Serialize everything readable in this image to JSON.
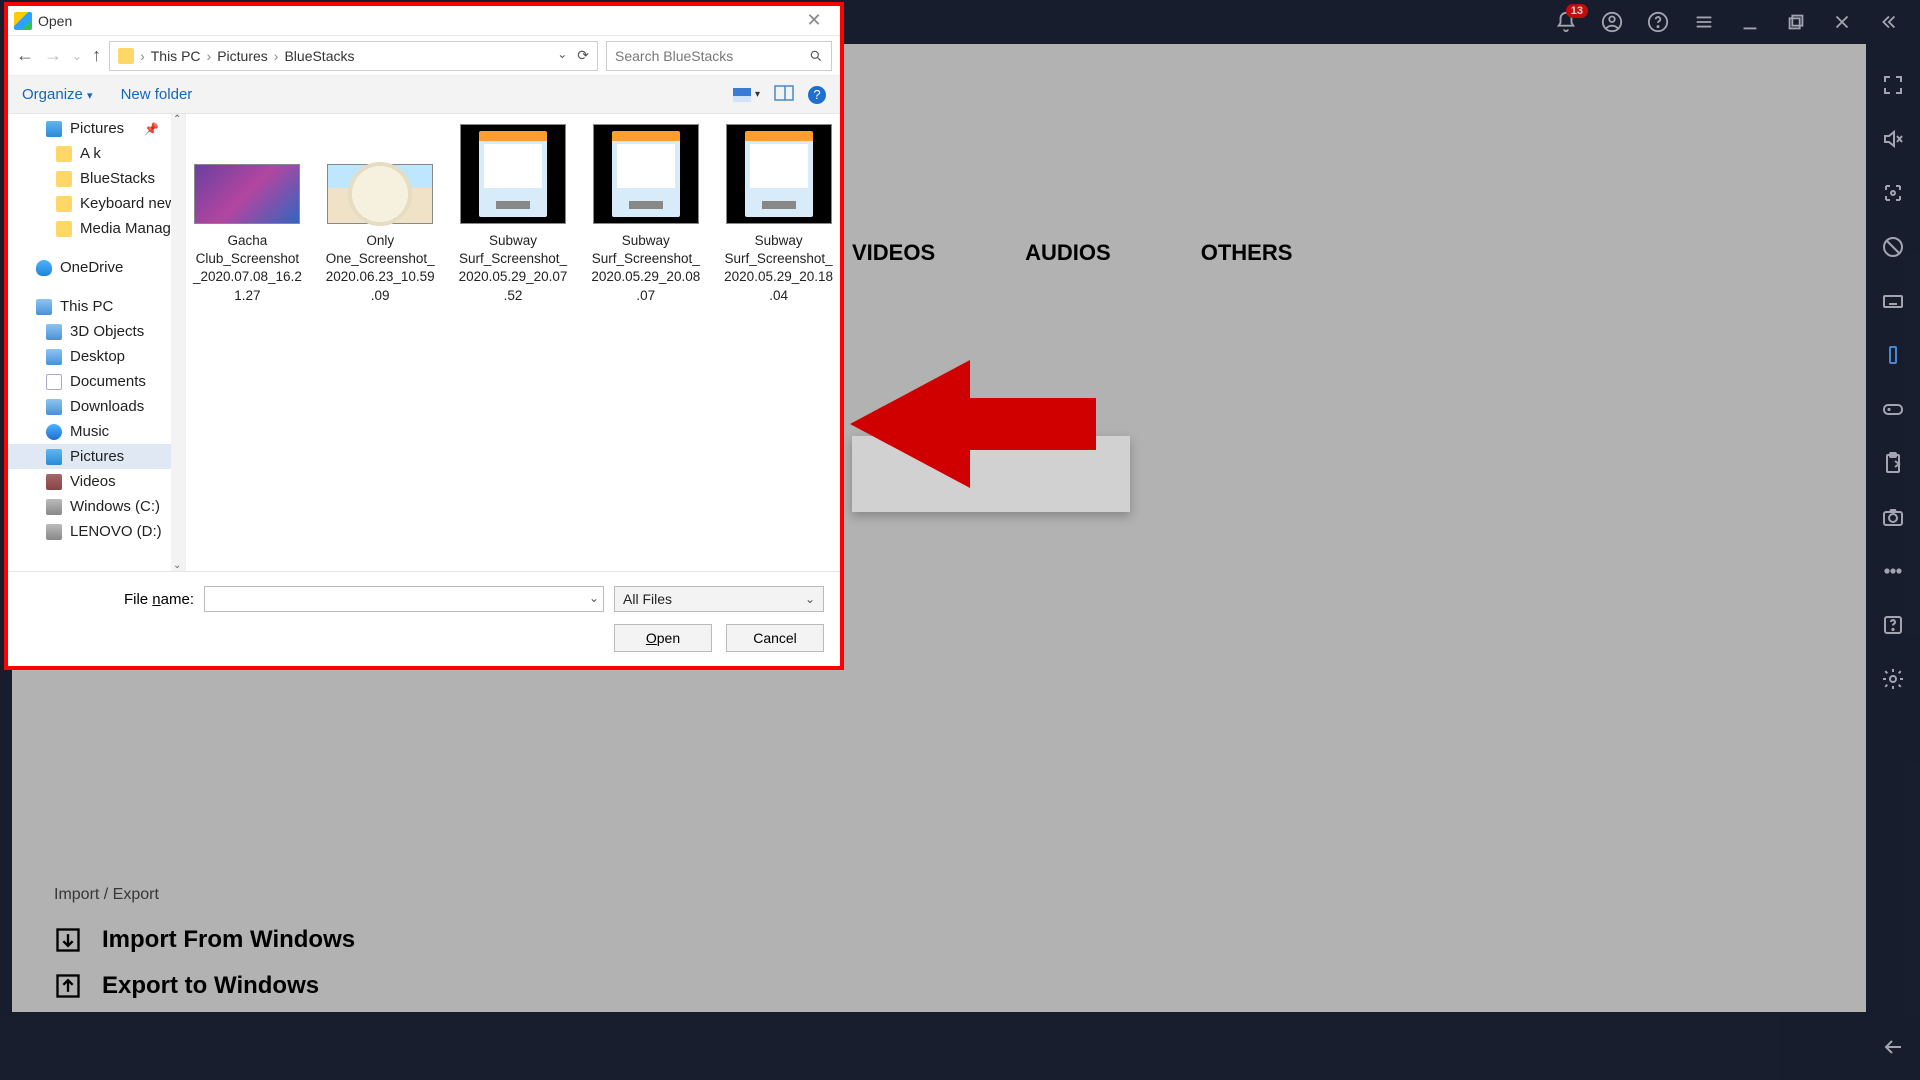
{
  "titlebar": {
    "badge": "13"
  },
  "app_tabs": {
    "videos": "VIDEOS",
    "audios": "AUDIOS",
    "others": "OTHERS"
  },
  "import": {
    "header": "Import / Export",
    "from": "Import From Windows",
    "to": "Export to Windows"
  },
  "dialog": {
    "title": "Open",
    "breadcrumb": {
      "root": "This PC",
      "p1": "Pictures",
      "p2": "BlueStacks"
    },
    "search_placeholder": "Search BlueStacks",
    "organize": "Organize",
    "new_folder": "New folder",
    "nav": {
      "pictures": "Pictures",
      "ak": "A k",
      "bluestacks": "BlueStacks",
      "keyboard": "Keyboard new",
      "media": "Media Manager",
      "onedrive": "OneDrive",
      "thispc": "This PC",
      "threed": "3D Objects",
      "desktop": "Desktop",
      "documents": "Documents",
      "downloads": "Downloads",
      "music": "Music",
      "pics2": "Pictures",
      "videos": "Videos",
      "winc": "Windows (C:)",
      "lenovo": "LENOVO (D:)"
    },
    "files": {
      "f0": "Gacha Club_Screenshot_2020.07.08_16.21.27",
      "f1": "Only One_Screenshot_2020.06.23_10.59.09",
      "f2": "Subway Surf_Screenshot_2020.05.29_20.07.52",
      "f3": "Subway Surf_Screenshot_2020.05.29_20.08.07",
      "f4": "Subway Surf_Screenshot_2020.05.29_20.18.04"
    },
    "file_name_label": "File name:",
    "file_name_value": "",
    "file_type": "All Files",
    "open_btn": "Open",
    "cancel_btn": "Cancel"
  }
}
